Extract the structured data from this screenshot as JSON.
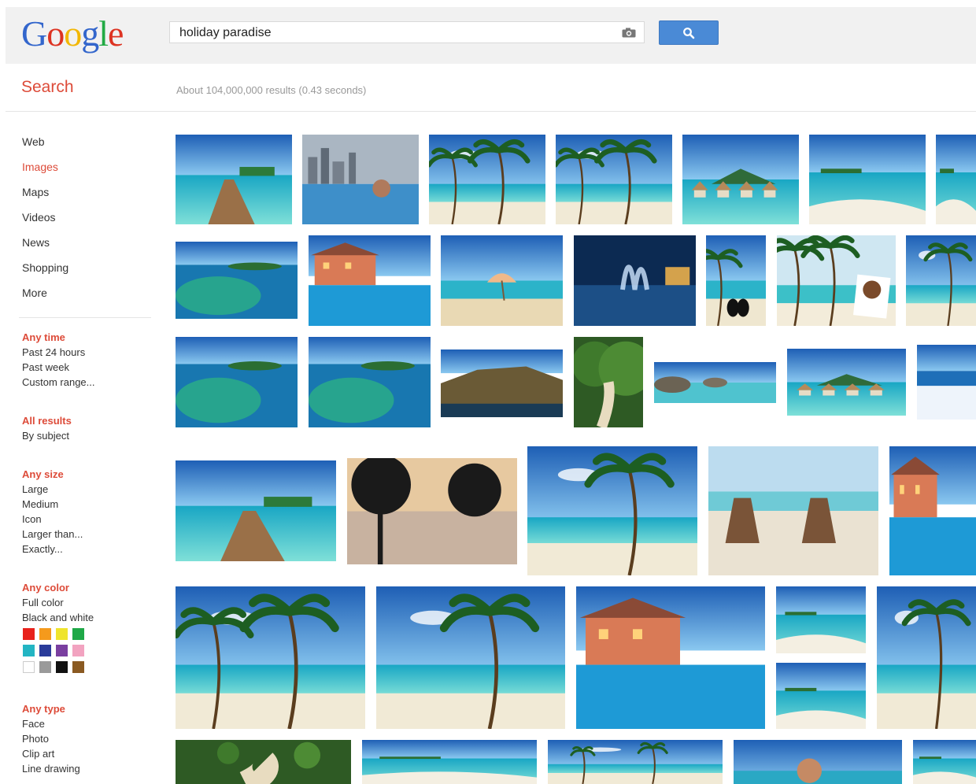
{
  "header": {
    "logo_letters": [
      {
        "ch": "G",
        "color": "#3366cc"
      },
      {
        "ch": "o",
        "color": "#dd3322"
      },
      {
        "ch": "o",
        "color": "#f2b705"
      },
      {
        "ch": "g",
        "color": "#3366cc"
      },
      {
        "ch": "l",
        "color": "#22aa44"
      },
      {
        "ch": "e",
        "color": "#dd3322"
      }
    ],
    "search_value": "holiday paradise",
    "camera_icon": "camera-icon",
    "search_button_icon": "magnifier-icon"
  },
  "search_label": "Search",
  "result_stats": "About 104,000,000 results (0.43 seconds)",
  "nav": {
    "items": [
      {
        "label": "Web",
        "active": false
      },
      {
        "label": "Images",
        "active": true
      },
      {
        "label": "Maps",
        "active": false
      },
      {
        "label": "Videos",
        "active": false
      },
      {
        "label": "News",
        "active": false
      },
      {
        "label": "Shopping",
        "active": false
      },
      {
        "label": "More",
        "active": false
      }
    ]
  },
  "tools": {
    "time": {
      "heading": "Any time",
      "options": [
        "Past 24 hours",
        "Past week",
        "Custom range..."
      ]
    },
    "results": {
      "heading": "All results",
      "options": [
        "By subject"
      ]
    },
    "size": {
      "heading": "Any size",
      "options": [
        "Large",
        "Medium",
        "Icon",
        "Larger than...",
        "Exactly..."
      ]
    },
    "color": {
      "heading": "Any color",
      "options": [
        "Full color",
        "Black and white"
      ],
      "swatches": [
        "#e8211b",
        "#f59a1c",
        "#efe42c",
        "#1fa847",
        "#23b5c3",
        "#2a3b9a",
        "#7a3fa0",
        "#f2a3c0",
        "#ffffff",
        "#9a9a9a",
        "#111111",
        "#8a5a22"
      ]
    },
    "type": {
      "heading": "Any type",
      "options": [
        "Face",
        "Photo",
        "Clip art",
        "Line drawing"
      ]
    }
  },
  "colors": {
    "accent": "#dd4b39",
    "brand_blue": "#4a8ad6",
    "header_bg": "#f1f1f1"
  },
  "results": [
    {
      "id": "r1-1",
      "scene": "pier"
    },
    {
      "id": "r1-2",
      "scene": "infinity-pool-city"
    },
    {
      "id": "r1-3",
      "scene": "palms-beach"
    },
    {
      "id": "r1-4",
      "scene": "palms-beach"
    },
    {
      "id": "r1-5",
      "scene": "overwater-bungalows"
    },
    {
      "id": "r1-6",
      "scene": "lagoon-kayak"
    },
    {
      "id": "r1-7",
      "scene": "beach-island"
    },
    {
      "id": "r2-1",
      "scene": "island-bay"
    },
    {
      "id": "r2-2",
      "scene": "resort-pool"
    },
    {
      "id": "r2-3",
      "scene": "beach-umbrella"
    },
    {
      "id": "r2-4",
      "scene": "night-fountain"
    },
    {
      "id": "r2-5",
      "scene": "beach-penguins"
    },
    {
      "id": "r2-6",
      "scene": "hammock-palms"
    },
    {
      "id": "r2-7",
      "scene": "palm-sea"
    },
    {
      "id": "r3-1",
      "scene": "reef-lagoon"
    },
    {
      "id": "r3-2",
      "scene": "tiny-island"
    },
    {
      "id": "r3-3",
      "scene": "cliff-town"
    },
    {
      "id": "r3-4",
      "scene": "jungle-path"
    },
    {
      "id": "r3-5",
      "scene": "rocky-shore"
    },
    {
      "id": "r3-6",
      "scene": "overwater-bungalows"
    },
    {
      "id": "r3-7",
      "scene": "snow-sea"
    },
    {
      "id": "r4-1",
      "scene": "pier-sunset"
    },
    {
      "id": "r4-2",
      "scene": "silhouette-trees"
    },
    {
      "id": "r4-3",
      "scene": "leaning-palm"
    },
    {
      "id": "r4-4",
      "scene": "deck-chairs"
    },
    {
      "id": "r4-5",
      "scene": "resort-pool"
    },
    {
      "id": "r5-1",
      "scene": "palms-beach"
    },
    {
      "id": "r5-2",
      "scene": "leaning-palm"
    },
    {
      "id": "r5-3",
      "scene": "villa-pool"
    },
    {
      "id": "r5-4",
      "scene": "beach-island"
    },
    {
      "id": "r5-5",
      "scene": "sandbar"
    },
    {
      "id": "r5-6",
      "scene": "palm-sea"
    },
    {
      "id": "r6-1",
      "scene": "jungle-hut"
    },
    {
      "id": "r6-2",
      "scene": "beach-island"
    },
    {
      "id": "r6-3",
      "scene": "palms-beach"
    },
    {
      "id": "r6-4",
      "scene": "person"
    },
    {
      "id": "r6-5",
      "scene": "beach-island"
    }
  ]
}
